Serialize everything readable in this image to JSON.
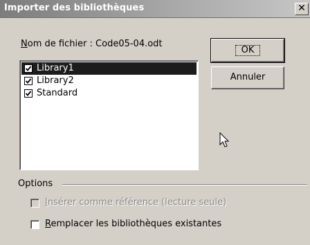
{
  "window": {
    "title": "Importer des bibliothèques",
    "close_icon": "close-icon"
  },
  "file": {
    "label_prefix_underlined": "N",
    "label_rest": "om de fichier : Code05-04.odt"
  },
  "libraries": [
    {
      "label": "Library1",
      "checked": true,
      "selected": true
    },
    {
      "label": "Library2",
      "checked": true,
      "selected": false
    },
    {
      "label": "Standard",
      "checked": true,
      "selected": false
    }
  ],
  "buttons": {
    "ok": "OK",
    "cancel": "Annuler"
  },
  "options": {
    "group_label": "Options",
    "insert_as_reference": {
      "underlined": "I",
      "rest": "nsérer comme référence (lecture seule)",
      "checked": false,
      "enabled": false
    },
    "replace_existing": {
      "underlined": "R",
      "rest": "emplacer les bibliothèques existantes",
      "checked": false,
      "enabled": true
    }
  },
  "colors": {
    "selection": "#1c1c1c",
    "face": "#d4d0c8",
    "disabled_text": "#8a8a8a"
  }
}
